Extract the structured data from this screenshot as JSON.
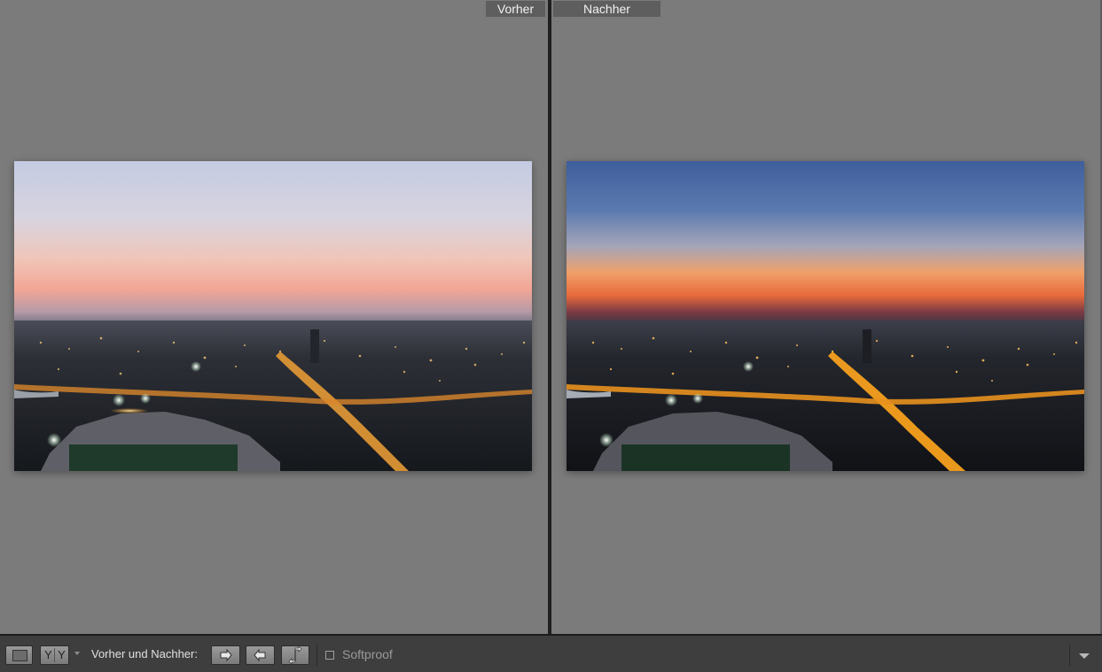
{
  "panes": {
    "before_label": "Vorher",
    "after_label": "Nachher"
  },
  "toolbar": {
    "loupe_view_icon": "single-view-icon",
    "compare_view_glyph_left": "Y",
    "compare_view_glyph_right": "Y",
    "before_after_label": "Vorher und Nachher:",
    "copy_before_to_after_icon": "arrow-right-icon",
    "copy_after_to_before_icon": "arrow-left-icon",
    "swap_icon": "swap-vertical-arrows-icon",
    "softproof_label": "Softproof",
    "softproof_checked": false,
    "menu_icon": "chevron-down-icon"
  },
  "colors": {
    "background": "#7b7b7b",
    "toolbar": "#3e3e3e",
    "label_bg": "#5e5e5e"
  }
}
